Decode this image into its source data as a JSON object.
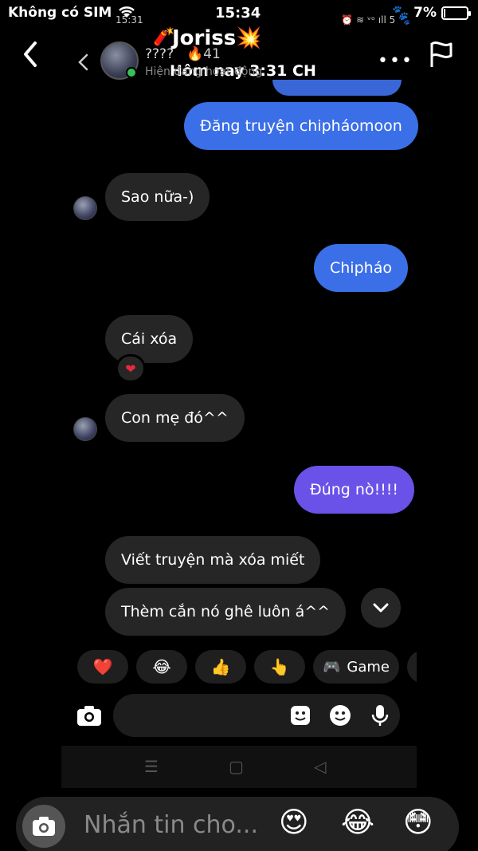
{
  "status_bar": {
    "carrier": "Không có SIM",
    "time": "15:34",
    "battery": "7%",
    "battery_level": 0.07
  },
  "inner_status": {
    "time": "15:31",
    "icons": "⏰ ≋ ᵛᵒ ıll 5 🐾"
  },
  "outer_header": {
    "title": "Joriss",
    "subtitle": "Hôm nay 3:31 CH"
  },
  "inner_header": {
    "contact_name": "????",
    "contact_count": "41",
    "contact_status": "Hiện đang hoạt động"
  },
  "messages": [
    {
      "side": "sent",
      "text": "Đăng truyện chipháomoon",
      "color": "#3b6fe8"
    },
    {
      "side": "received",
      "text": "Sao nữa-)"
    },
    {
      "side": "sent",
      "text": "Chipháo",
      "color": "#3b6fe8"
    },
    {
      "side": "received",
      "text": "Cái xóa",
      "reaction": "❤"
    },
    {
      "side": "received",
      "text": "Con mẹ đó^^"
    },
    {
      "side": "sent",
      "text": "Đúng nò!!!!",
      "color": "#6a52e8"
    },
    {
      "side": "received",
      "text": "Viết truyện mà xóa miết"
    },
    {
      "side": "received",
      "text": "Thèm cắn nó ghê luôn á^^"
    }
  ],
  "quick_reactions": [
    {
      "icon": "❤️",
      "name": "heart"
    },
    {
      "icon": "😂",
      "name": "laughing"
    },
    {
      "icon": "👍",
      "name": "thumbs-up"
    },
    {
      "icon": "👆",
      "name": "pointing"
    },
    {
      "icon": "🎮",
      "label": "Game",
      "name": "game"
    }
  ],
  "outer_composer": {
    "placeholder": "Nhắn tin cho...",
    "emojis": [
      "😍",
      "😂",
      "😳"
    ]
  },
  "colors": {
    "sent_blue": "#3b6fe8",
    "sent_violet": "#6a52e8",
    "received": "#262626",
    "online": "#36c15a"
  }
}
